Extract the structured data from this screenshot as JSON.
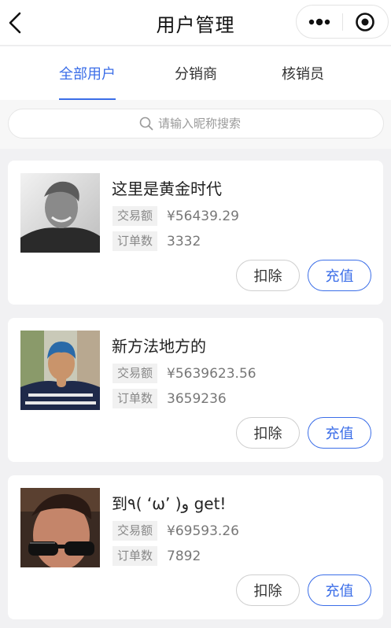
{
  "navbar": {
    "title": "用户管理",
    "back_icon": "chevron-left-icon",
    "more_icon": "more-dots-icon",
    "close_icon": "target-close-icon"
  },
  "tabs": [
    {
      "label": "全部用户",
      "active": true
    },
    {
      "label": "分销商",
      "active": false
    },
    {
      "label": "核销员",
      "active": false
    }
  ],
  "search": {
    "placeholder": "请输入昵称搜索",
    "icon": "search-icon"
  },
  "colors": {
    "accent": "#3b6ee8",
    "page_bg": "#f1f1f3"
  },
  "users": [
    {
      "name": "这里是黄金时代",
      "trade_label": "交易额",
      "trade_amount": "¥56439.29",
      "order_label": "订单数",
      "order_count": "3332",
      "deduct_label": "扣除",
      "recharge_label": "充值"
    },
    {
      "name": "新方法地方的",
      "trade_label": "交易额",
      "trade_amount": "¥5639623.56",
      "order_label": "订单数",
      "order_count": "3659236",
      "deduct_label": "扣除",
      "recharge_label": "充值"
    },
    {
      "name": "到٩( ‘ω’ )و get!",
      "trade_label": "交易额",
      "trade_amount": "¥69593.26",
      "order_label": "订单数",
      "order_count": "7892",
      "deduct_label": "扣除",
      "recharge_label": "充值"
    }
  ]
}
